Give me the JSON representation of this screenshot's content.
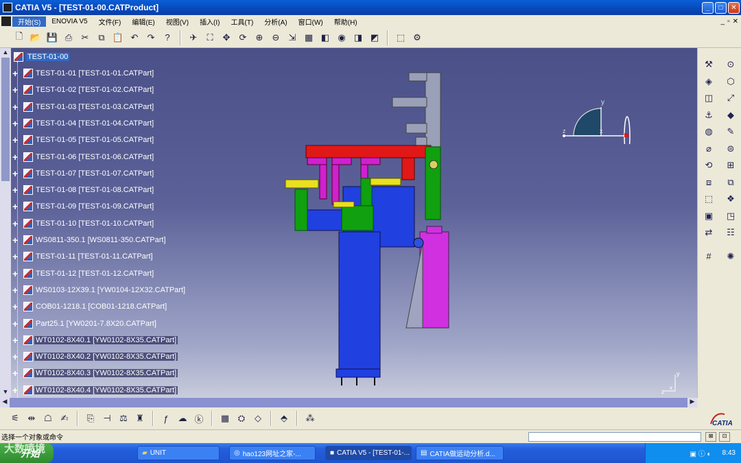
{
  "window": {
    "title": "CATIA V5 - [TEST-01-00.CATProduct]",
    "min": "_",
    "max": "□",
    "close": "✕"
  },
  "menu": {
    "items": [
      "开始(S)",
      "ENOVIA V5",
      "文件(F)",
      "编辑(E)",
      "视图(V)",
      "插入(I)",
      "工具(T)",
      "分析(A)",
      "窗口(W)",
      "帮助(H)"
    ],
    "mdi_min": "_",
    "mdi_restore": "▫",
    "mdi_close": "✕"
  },
  "toolbar": {
    "icons": [
      "new-icon",
      "open-icon",
      "save-icon",
      "print-icon",
      "cut-icon",
      "copy-icon",
      "paste-icon",
      "undo-icon",
      "redo-icon",
      "whats-this-icon",
      "fly-icon",
      "fit-all-icon",
      "pan-icon",
      "rotate-icon",
      "zoom-in-icon",
      "zoom-out-icon",
      "normal-view-icon",
      "multi-view-icon",
      "iso-view-icon",
      "render-style-icon",
      "hide-show-icon",
      "swap-space-icon",
      "catalog-icon",
      "product-icon"
    ]
  },
  "tree": {
    "root": "TEST-01-00",
    "nodes": [
      {
        "label": "TEST-01-01 [TEST-01-01.CATPart]",
        "boxed": false
      },
      {
        "label": "TEST-01-02 [TEST-01-02.CATPart]",
        "boxed": false
      },
      {
        "label": "TEST-01-03 [TEST-01-03.CATPart]",
        "boxed": false
      },
      {
        "label": "TEST-01-04 [TEST-01-04.CATPart]",
        "boxed": false
      },
      {
        "label": "TEST-01-05 [TEST-01-05.CATPart]",
        "boxed": false
      },
      {
        "label": "TEST-01-06 [TEST-01-06.CATPart]",
        "boxed": false
      },
      {
        "label": "TEST-01-07 [TEST-01-07.CATPart]",
        "boxed": false
      },
      {
        "label": "TEST-01-08 [TEST-01-08.CATPart]",
        "boxed": false
      },
      {
        "label": "TEST-01-09 [TEST-01-09.CATPart]",
        "boxed": false
      },
      {
        "label": "TEST-01-10 [TEST-01-10.CATPart]",
        "boxed": false
      },
      {
        "label": "WS0811-350.1 [WS0811-350.CATPart]",
        "boxed": false
      },
      {
        "label": "TEST-01-11 [TEST-01-11.CATPart]",
        "boxed": false
      },
      {
        "label": "TEST-01-12 [TEST-01-12.CATPart]",
        "boxed": false
      },
      {
        "label": "WS0103-12X39.1 [YW0104-12X32.CATPart]",
        "boxed": false
      },
      {
        "label": "COB01-1218.1 [COB01-1218.CATPart]",
        "boxed": false
      },
      {
        "label": "Part25.1 [YW0201-7.8X20.CATPart]",
        "boxed": false
      },
      {
        "label": "WT0102-8X40.1 [YW0102-8X35.CATPart]",
        "boxed": true
      },
      {
        "label": "WT0102-8X40.2 [YW0102-8X35.CATPart]",
        "boxed": true
      },
      {
        "label": "WT0102-8X40.3 [YW0102-8X35.CATPart]",
        "boxed": true
      },
      {
        "label": "WT0102-8X40.4 [YW0102-8X35.CATPart]",
        "boxed": true
      }
    ]
  },
  "compass": {
    "x": "x",
    "y": "y",
    "z": "z"
  },
  "axis_small": {
    "y": "y",
    "z": "z",
    "x": "x"
  },
  "right_toolbar": {
    "icons": [
      "manipulation-icon",
      "snap-icon",
      "explode-icon",
      "clash-icon",
      "sectioning-icon",
      "distance-icon",
      "constraint-icon",
      "fix-icon",
      "contact-icon",
      "offset-icon",
      "angle-icon",
      "coincidence-icon",
      "update-icon",
      "reuse-pattern-icon",
      "multi-instantiation-icon",
      "fast-multi-instance-icon",
      "existing-component-icon",
      "new-part-icon",
      "new-product-icon",
      "new-component-icon",
      "replace-icon",
      "graph-tree-icon",
      "generate-numbering-icon",
      "flexible-icon"
    ]
  },
  "bottom_toolbar": {
    "icons": [
      "sketch-icon",
      "dimension-icon",
      "annotation-icon",
      "text-icon",
      "catalog-browser-icon",
      "measure-icon",
      "inertia-icon",
      "bottle-icon",
      "formula-icon",
      "comment-icon",
      "knowledge-icon",
      "table-icon",
      "part-design-icon",
      "material-icon",
      "apply-material-icon",
      "grid-icon"
    ]
  },
  "catia_logo": "CATIA",
  "status": {
    "text": "选择一个对象或命令",
    "cmd_value": ""
  },
  "taskbar": {
    "start": "开始",
    "tasks": [
      {
        "label": "UNIT",
        "active": false
      },
      {
        "label": "hao123网址之家-...",
        "active": false
      },
      {
        "label": "CATIA V5 - [TEST-01-...",
        "active": true
      },
      {
        "label": "CATIA做运动分析.d...",
        "active": false
      }
    ],
    "clock": "8:43"
  },
  "watermark": "大数喷境"
}
